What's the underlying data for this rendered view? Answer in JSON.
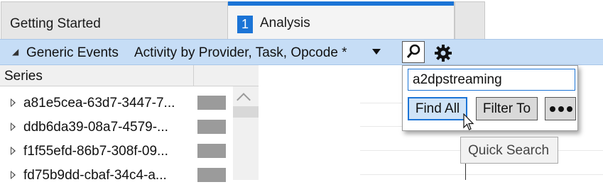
{
  "tabs": [
    {
      "label": "Getting Started"
    },
    {
      "number": "1",
      "label": "Analysis"
    }
  ],
  "header": {
    "title": "Generic Events",
    "preset": "Activity by Provider, Task, Opcode *"
  },
  "series_panel": {
    "column_header": "Series",
    "rows": [
      {
        "name": "a81e5cea-63d7-3447-7..."
      },
      {
        "name": "ddb6da39-08a7-4579-..."
      },
      {
        "name": "f1f55efd-86b7-308f-09..."
      },
      {
        "name": "fd75b9dd-cbaf-34c4-a..."
      }
    ]
  },
  "quick_search": {
    "query": "a2dpstreaming",
    "find_all_label": "Find All",
    "filter_to_label": "Filter To",
    "tooltip": "Quick Search"
  },
  "colors": {
    "accent": "#1b74d6",
    "header_bar": "#c6ddf6",
    "swatch": "#9b9b9b"
  }
}
